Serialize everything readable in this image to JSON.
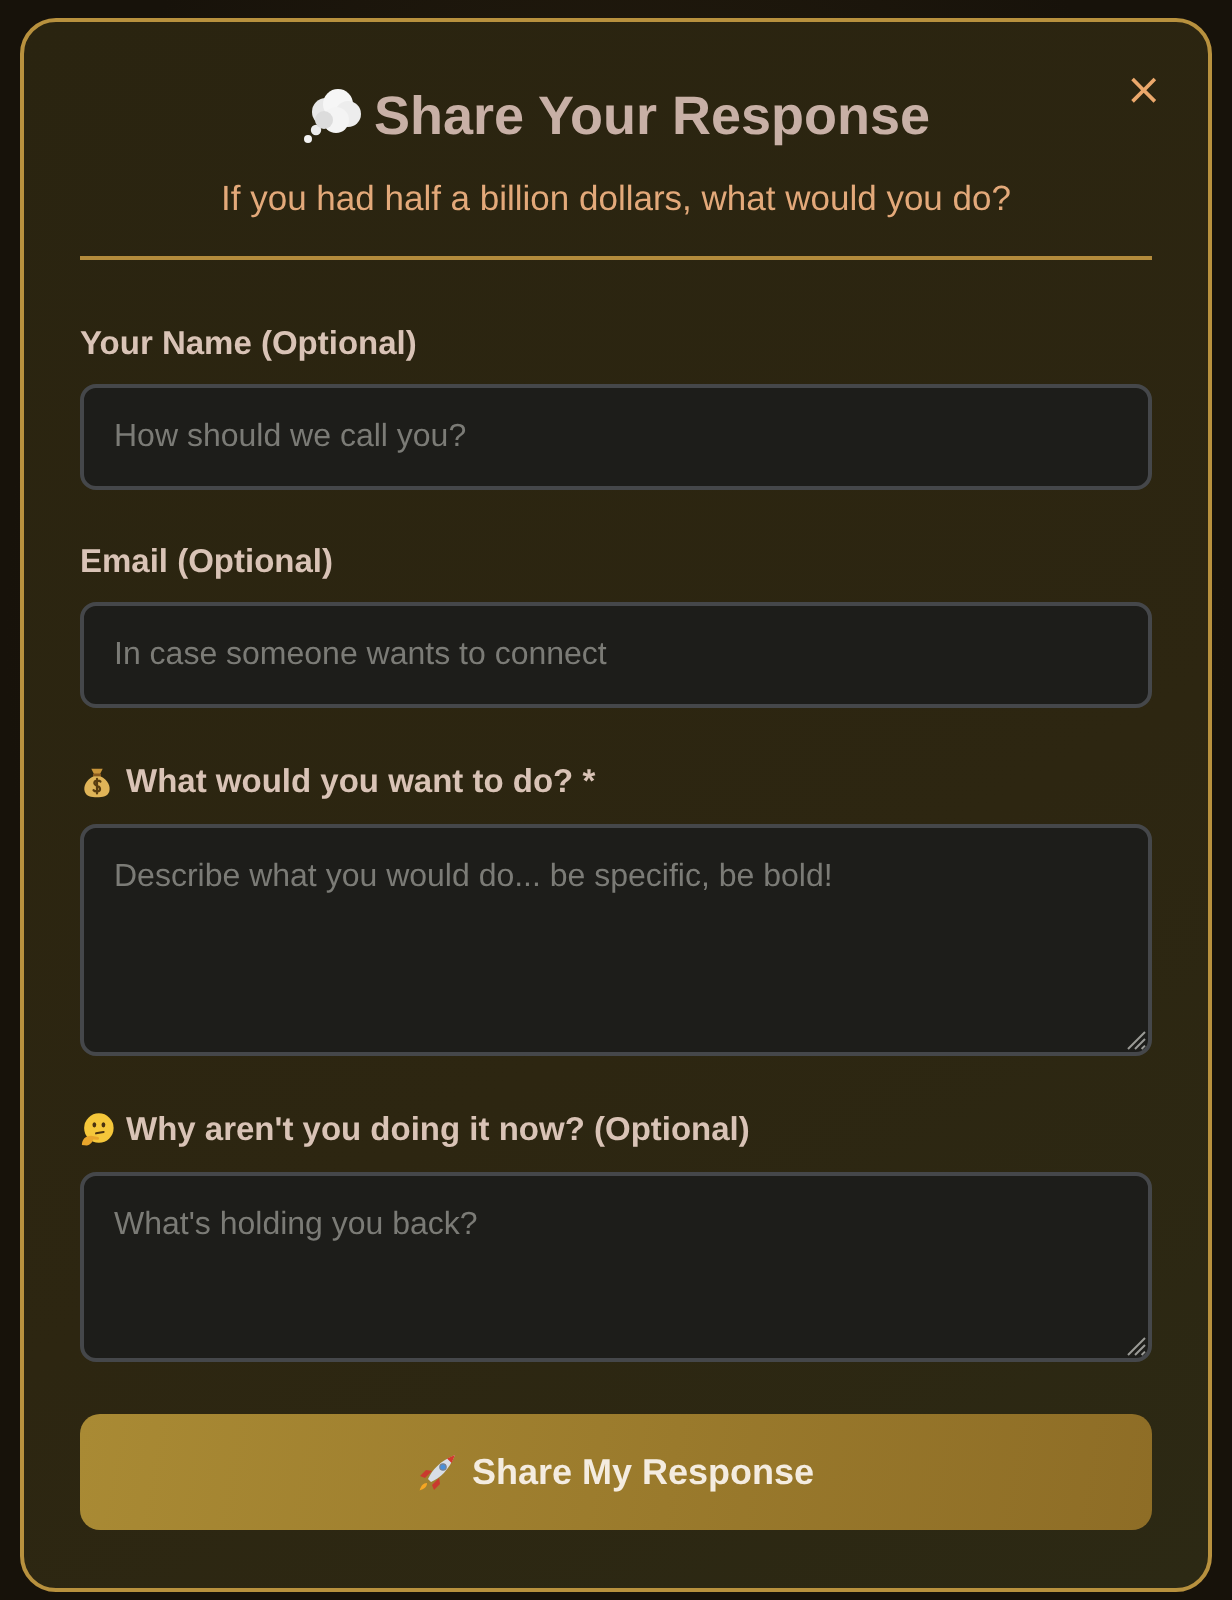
{
  "dialog": {
    "title": "Share Your Response",
    "subtitle": "If you had half a billion dollars, what would you do?",
    "close": "×"
  },
  "fields": [
    {
      "kind": "input",
      "label": "Your Name (Optional)",
      "placeholder": "How should we call you?"
    },
    {
      "kind": "input",
      "label": "Email (Optional)",
      "placeholder": "In case someone wants to connect"
    },
    {
      "kind": "textarea",
      "label": "What would you want to do? *",
      "placeholder": "Describe what you would do... be specific, be bold!"
    },
    {
      "kind": "textarea",
      "label": "Why aren't you doing it now? (Optional)",
      "placeholder": "What's holding you back?"
    }
  ],
  "submit": {
    "label": "Share My Response"
  }
}
